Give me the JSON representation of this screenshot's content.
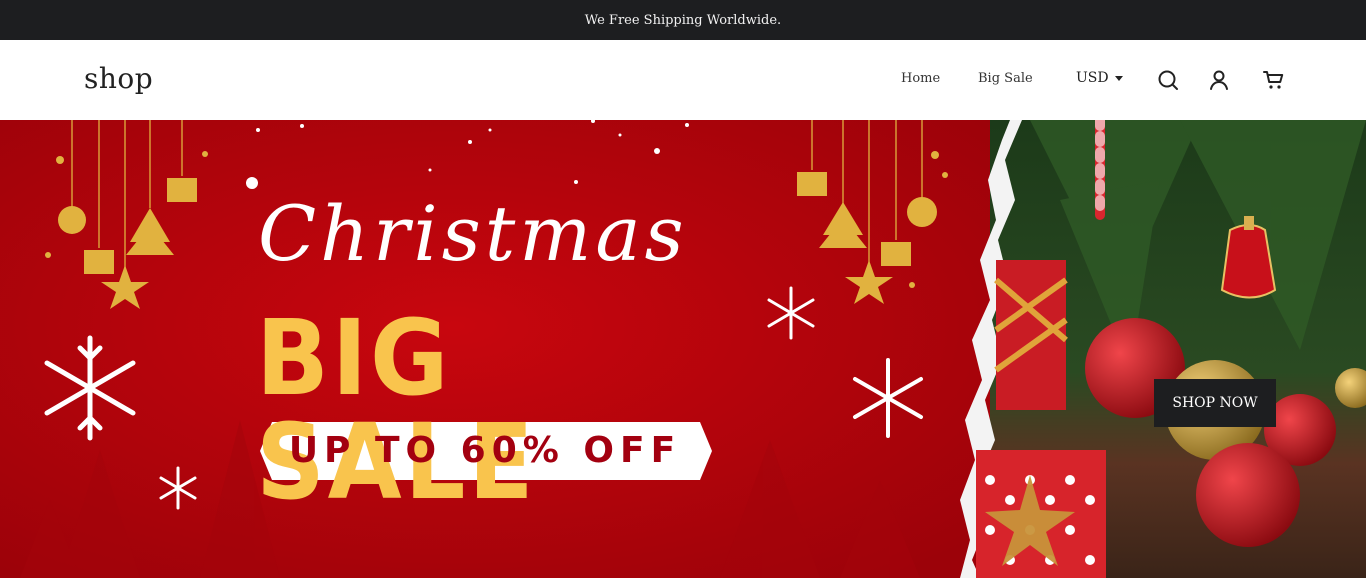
{
  "announcement": {
    "text": "We Free Shipping Worldwide."
  },
  "header": {
    "logo": "shop",
    "nav": [
      {
        "label": "Home"
      },
      {
        "label": "Big Sale"
      }
    ],
    "currency": "USD",
    "icons": [
      "search-icon",
      "account-icon",
      "cart-icon"
    ]
  },
  "hero": {
    "script_title": "Christmas",
    "headline": "BIG SALE",
    "ribbon": "UP TO 60% OFF",
    "cta": "SHOP NOW",
    "colors": {
      "background": "#b0030a",
      "gold": "#f9c44d",
      "ribbon_text": "#a30010",
      "cta_bg": "#1d1e20"
    }
  }
}
